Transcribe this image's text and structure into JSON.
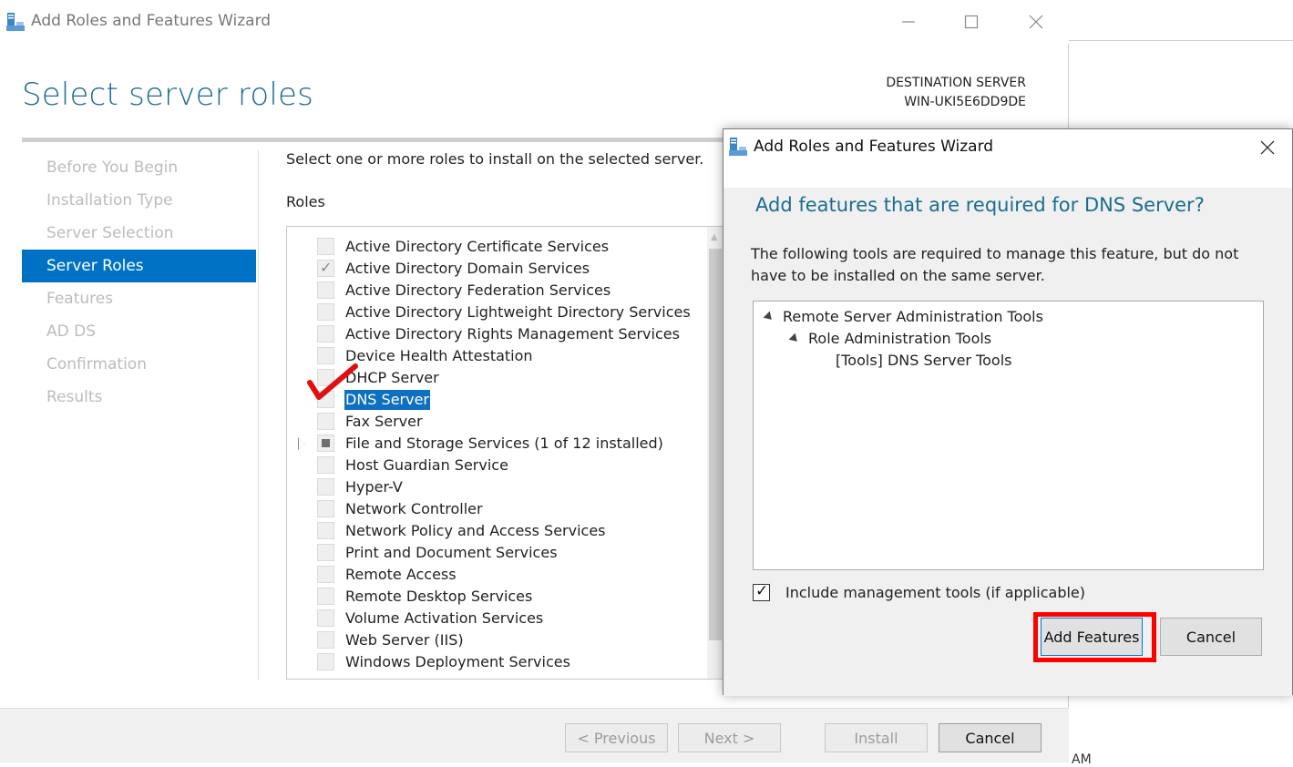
{
  "main_window": {
    "title": "Add Roles and Features Wizard",
    "page_title": "Select server roles",
    "destination_label": "DESTINATION SERVER",
    "destination_name": "WIN-UKI5E6DD9DE",
    "instruction": "Select one or more roles to install on the selected server.",
    "roles_heading": "Roles"
  },
  "nav": {
    "items": [
      {
        "label": "Before You Begin",
        "active": false
      },
      {
        "label": "Installation Type",
        "active": false
      },
      {
        "label": "Server Selection",
        "active": false
      },
      {
        "label": "Server Roles",
        "active": true
      },
      {
        "label": "Features",
        "active": false
      },
      {
        "label": "AD DS",
        "active": false
      },
      {
        "label": "Confirmation",
        "active": false
      },
      {
        "label": "Results",
        "active": false
      }
    ]
  },
  "roles": [
    {
      "label": "Active Directory Certificate Services",
      "state": "unchecked"
    },
    {
      "label": "Active Directory Domain Services",
      "state": "checked"
    },
    {
      "label": "Active Directory Federation Services",
      "state": "unchecked"
    },
    {
      "label": "Active Directory Lightweight Directory Services",
      "state": "unchecked"
    },
    {
      "label": "Active Directory Rights Management Services",
      "state": "unchecked"
    },
    {
      "label": "Device Health Attestation",
      "state": "unchecked"
    },
    {
      "label": "DHCP Server",
      "state": "unchecked"
    },
    {
      "label": "DNS Server",
      "state": "unchecked",
      "selected": true
    },
    {
      "label": "Fax Server",
      "state": "unchecked"
    },
    {
      "label": "File and Storage Services (1 of 12 installed)",
      "state": "partial",
      "expandable": true
    },
    {
      "label": "Host Guardian Service",
      "state": "unchecked"
    },
    {
      "label": "Hyper-V",
      "state": "unchecked"
    },
    {
      "label": "Network Controller",
      "state": "unchecked"
    },
    {
      "label": "Network Policy and Access Services",
      "state": "unchecked"
    },
    {
      "label": "Print and Document Services",
      "state": "unchecked"
    },
    {
      "label": "Remote Access",
      "state": "unchecked"
    },
    {
      "label": "Remote Desktop Services",
      "state": "unchecked"
    },
    {
      "label": "Volume Activation Services",
      "state": "unchecked"
    },
    {
      "label": "Web Server (IIS)",
      "state": "unchecked"
    },
    {
      "label": "Windows Deployment Services",
      "state": "unchecked"
    }
  ],
  "buttons": {
    "previous": "< Previous",
    "next": "Next >",
    "install": "Install",
    "cancel": "Cancel"
  },
  "dialog": {
    "title": "Add Roles and Features Wizard",
    "heading": "Add features that are required for DNS Server?",
    "description": "The following tools are required to manage this feature, but do not have to be installed on the same server.",
    "tree": [
      {
        "label": "Remote Server Administration Tools",
        "level": 0,
        "expanded": true
      },
      {
        "label": "Role Administration Tools",
        "level": 1,
        "expanded": true
      },
      {
        "label": "[Tools] DNS Server Tools",
        "level": 2
      }
    ],
    "include_label": "Include management tools (if applicable)",
    "include_checked": true,
    "add_features": "Add Features",
    "cancel": "Cancel"
  },
  "background": {
    "bottom_text": "AM"
  },
  "colors": {
    "accent": "#0072c6",
    "title_blue": "#1b6d8f",
    "highlight_red": "#ff0000"
  }
}
